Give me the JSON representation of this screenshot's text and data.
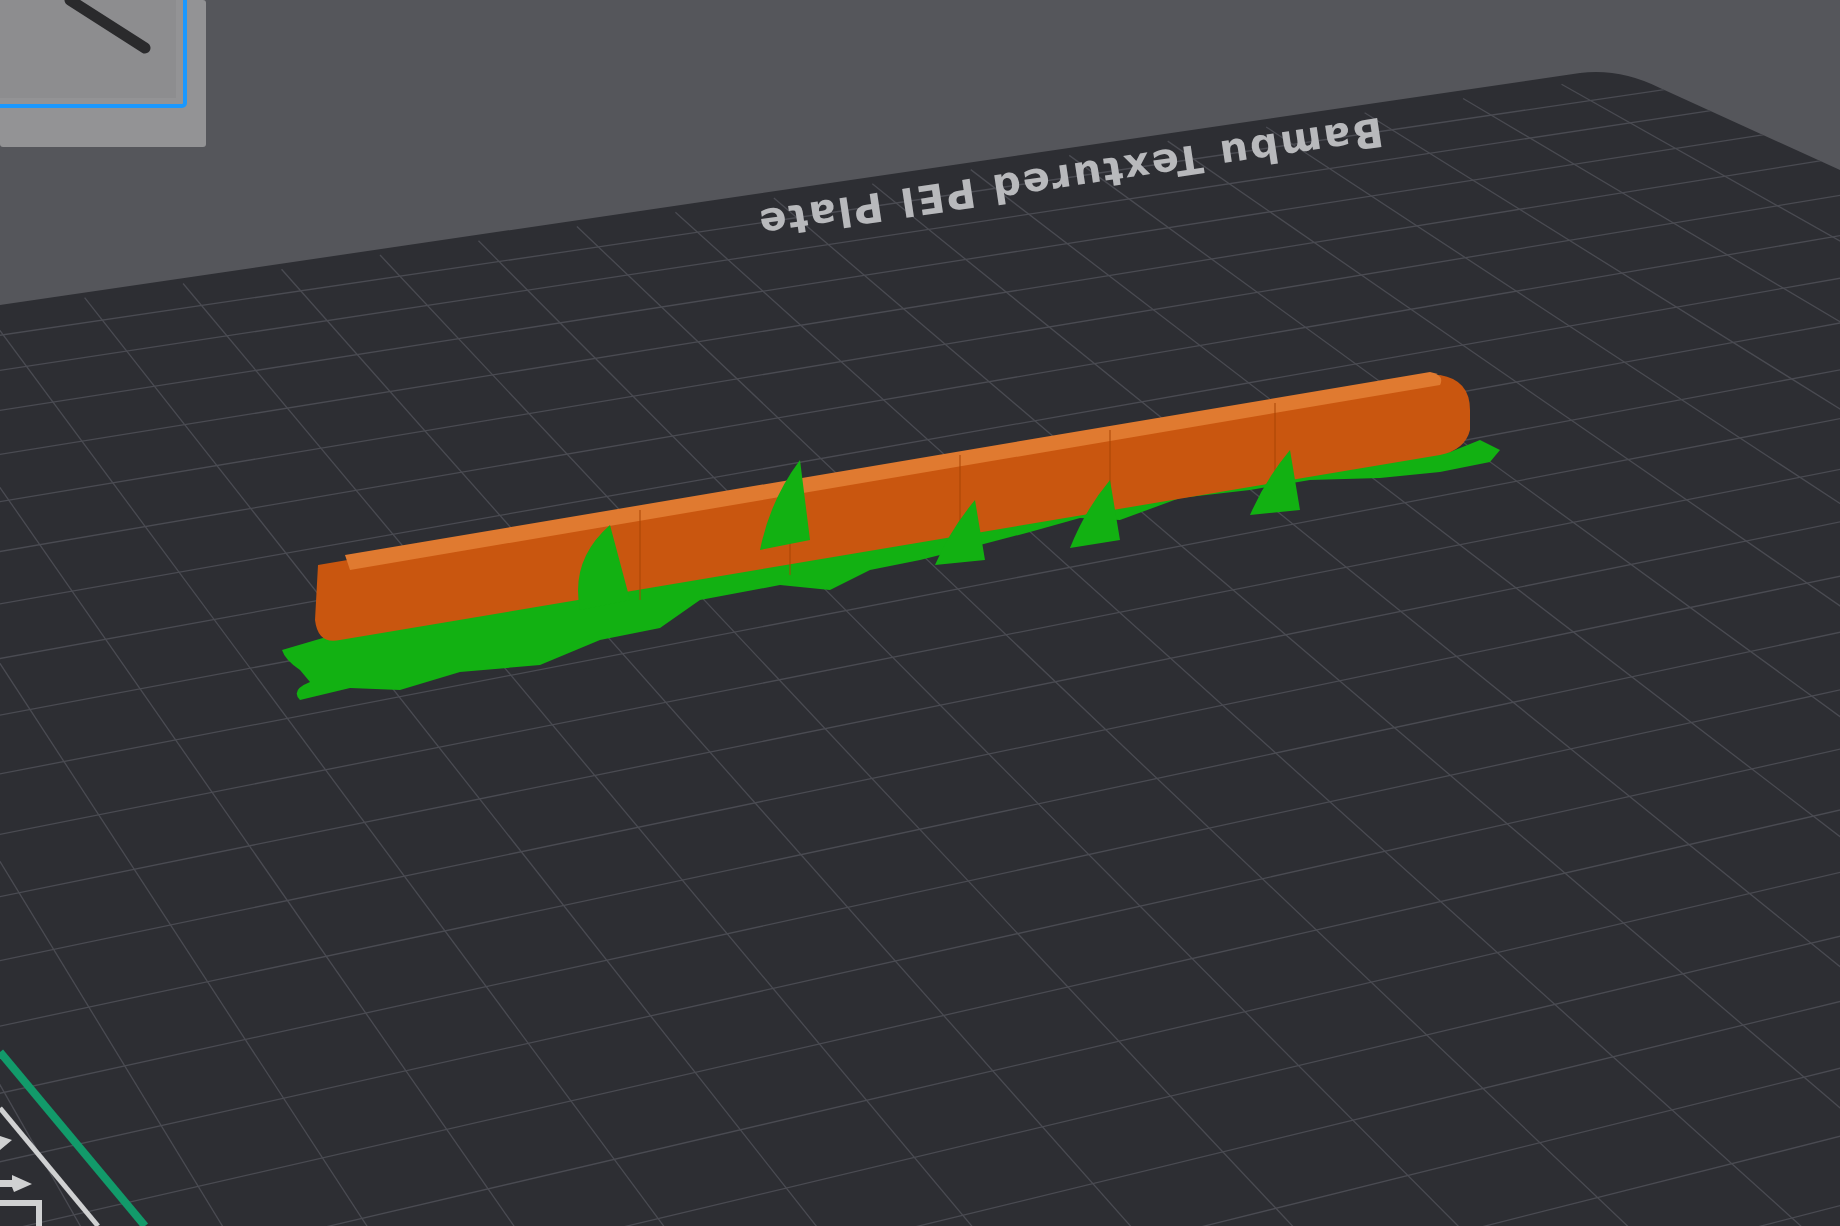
{
  "viewport": {
    "plate_label": "Bambu Textured PEI Plate",
    "plate_thumbnail": {
      "selected": true
    }
  }
}
